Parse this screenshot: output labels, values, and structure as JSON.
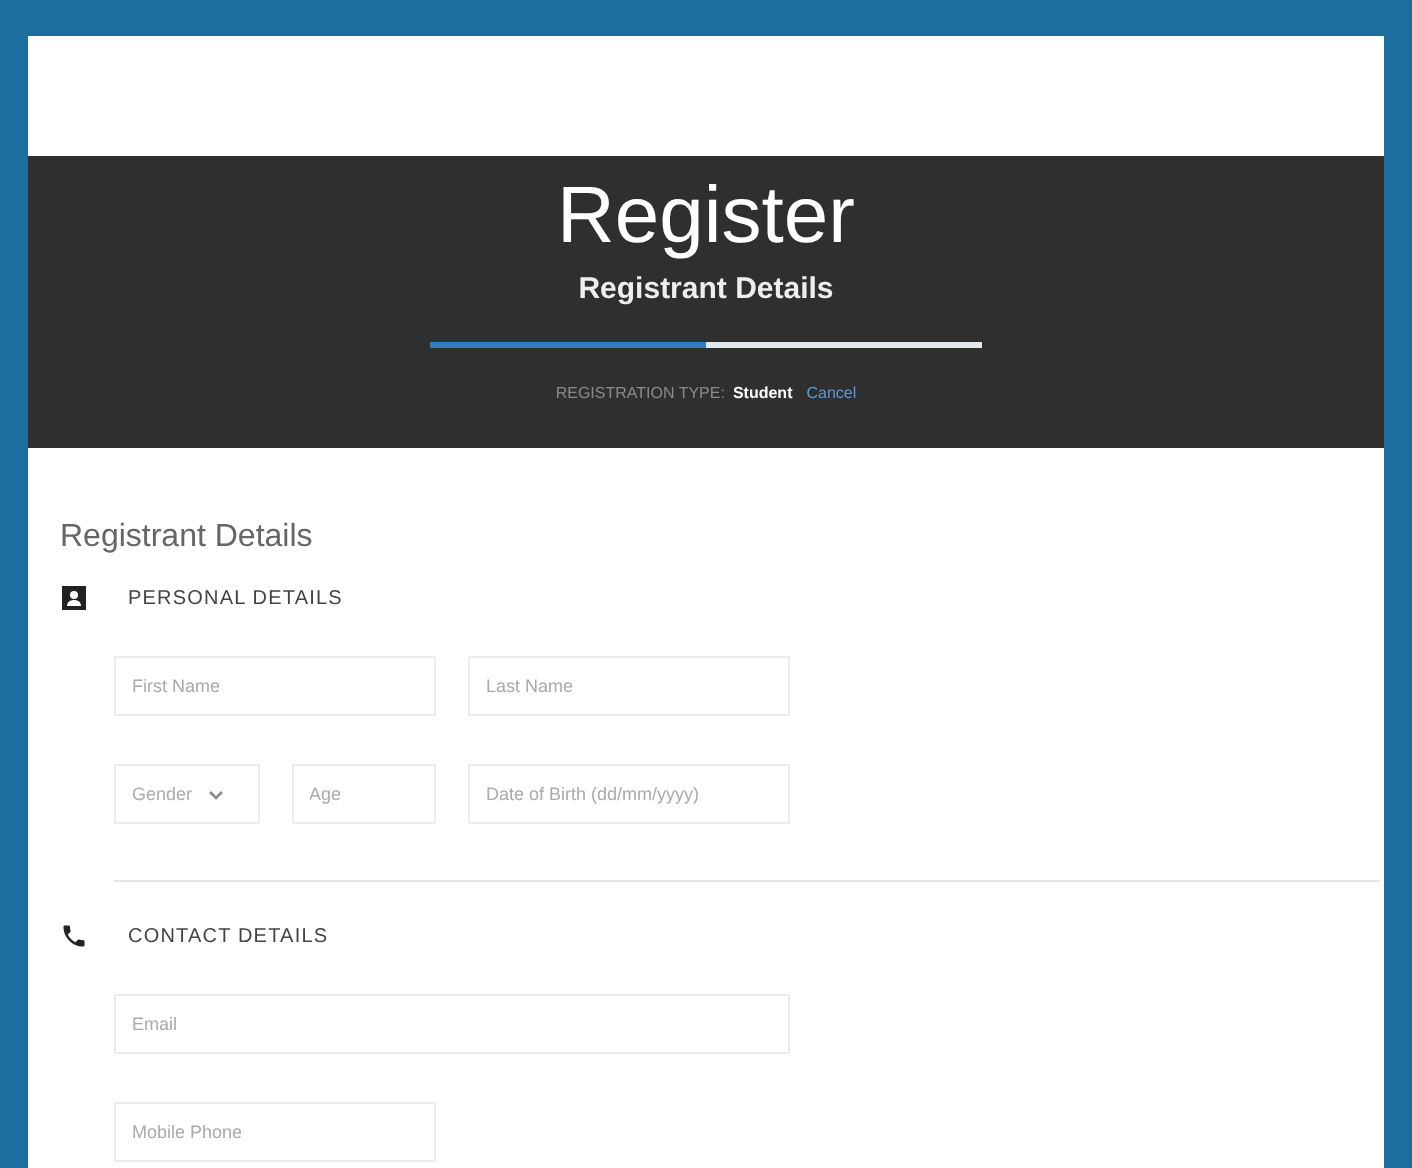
{
  "header": {
    "title": "Register",
    "subtitle": "Registrant Details",
    "progress": {
      "level": 0.5
    },
    "registration_type_label": "REGISTRATION TYPE:",
    "registration_type": "Student",
    "cancel_link": "Cancel"
  },
  "form": {
    "heading": "Registrant Details",
    "sections": [
      {
        "title": "PERSONAL DETAILS",
        "fields": [
          {
            "kind": "text",
            "placeholder": "First Name"
          },
          {
            "kind": "text",
            "placeholder": "Last Name"
          },
          {
            "kind": "select",
            "placeholder": "Gender"
          },
          {
            "kind": "text",
            "placeholder": "Age"
          },
          {
            "kind": "text",
            "placeholder": "Date of Birth (dd/mm/yyyy)"
          }
        ]
      },
      {
        "title": "CONTACT DETAILS",
        "fields": [
          {
            "kind": "text",
            "placeholder": "Email"
          },
          {
            "kind": "text",
            "placeholder": "Mobile Phone"
          }
        ]
      }
    ]
  }
}
